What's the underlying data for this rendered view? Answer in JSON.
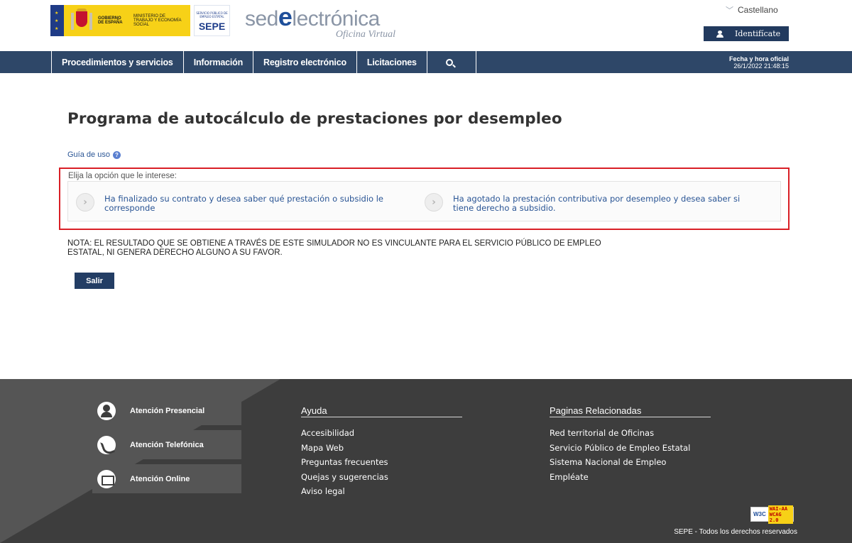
{
  "header": {
    "gov_logo_text": "GOBIERNO DE ESPAÑA",
    "ministry_text": "MINISTERIO DE TRABAJO Y ECONOMÍA SOCIAL",
    "sepe_small_text": "SERVICIO PÚBLICO DE EMPLEO ESTATAL",
    "sepe_big_text": "SEPE",
    "brand_pre": "sed",
    "brand_e": "e",
    "brand_post": "lectrónica",
    "brand_sub": "Oficina Virtual",
    "language": "Castellano",
    "identify_label": "Identifícate"
  },
  "nav": {
    "items": [
      {
        "label": "Procedimientos y servicios"
      },
      {
        "label": "Información"
      },
      {
        "label": "Registro electrónico"
      },
      {
        "label": "Licitaciones"
      }
    ],
    "clock_label": "Fecha y hora oficial",
    "clock_value": "26/1/2022 21:48:15"
  },
  "main": {
    "title": "Programa de autocálculo de prestaciones por desempleo",
    "guide_link": "Guía de uso",
    "options_label": "Elija la opción que le interese:",
    "options": [
      {
        "text": "Ha finalizado su contrato y desea saber qué prestación o subsidio le corresponde"
      },
      {
        "text": "Ha agotado la prestación contributiva por desempleo y desea saber si tiene derecho a subsidio."
      }
    ],
    "note": "NOTA: EL RESULTADO QUE SE OBTIENE A TRAVÉS DE ESTE SIMULADOR NO ES VINCULANTE PARA EL SERVICIO PÚBLICO DE EMPLEO ESTATAL, NI GENERA DERECHO ALGUNO A SU FAVOR.",
    "exit_button": "Salir"
  },
  "footer": {
    "attention": [
      {
        "label": "Atención Presencial",
        "icon": "person-icon"
      },
      {
        "label": "Atención Telefónica",
        "icon": "phone-icon"
      },
      {
        "label": "Atención Online",
        "icon": "monitor-icon"
      }
    ],
    "help": {
      "heading": "Ayuda",
      "links": [
        "Accesibilidad",
        "Mapa Web",
        "Preguntas frecuentes",
        "Quejas y sugerencias",
        "Aviso legal"
      ]
    },
    "related": {
      "heading": "Paginas Relacionadas",
      "links": [
        "Red territorial de Oficinas",
        "Servicio Público de Empleo Estatal",
        "Sistema Nacional de Empleo",
        "Empléate"
      ]
    },
    "wai_w3c": "W3C",
    "wai_level": "WAI-AA",
    "wai_wcag": "WCAG 2.0",
    "copyright": "SEPE - Todos los derechos reservados"
  },
  "colors": {
    "nav_bg": "#2e4768",
    "accent_blue": "#1f4f9a",
    "highlight_red": "#d91f26",
    "footer_bg": "#3d3d3d"
  }
}
